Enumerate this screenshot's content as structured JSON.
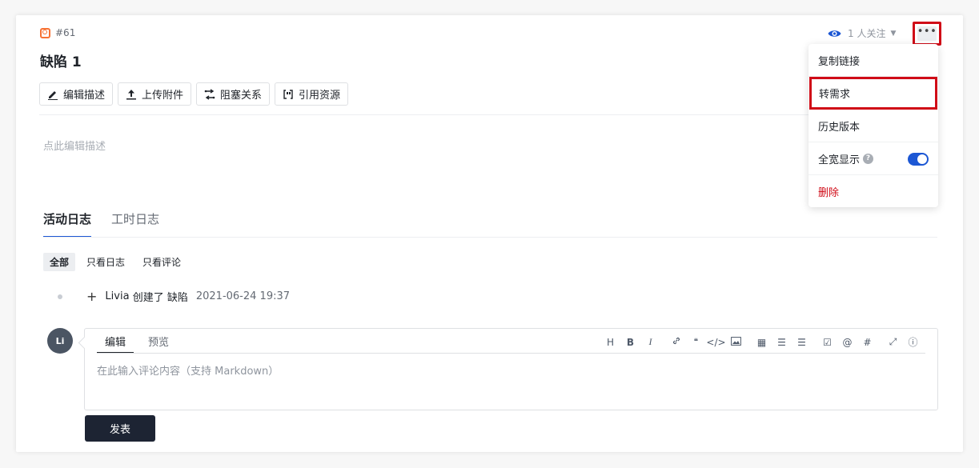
{
  "issue": {
    "id": "#61",
    "title": "缺陷 1",
    "icon": "bug-square-icon",
    "icon_color": "#f77234"
  },
  "watch": {
    "label": "1 人关注",
    "icon": "eye-icon",
    "color": "#1c57d4"
  },
  "more": {
    "label": "•••"
  },
  "toolbar": [
    {
      "label": "编辑描述",
      "icon": "pencil-icon"
    },
    {
      "label": "上传附件",
      "icon": "upload-icon"
    },
    {
      "label": "阻塞关系",
      "icon": "relation-icon"
    },
    {
      "label": "引用资源",
      "icon": "quote-icon"
    }
  ],
  "description": {
    "placeholder": "点此编辑描述"
  },
  "tabs": [
    {
      "label": "活动日志",
      "active": true
    },
    {
      "label": "工时日志",
      "active": false
    }
  ],
  "filters": [
    {
      "label": "全部",
      "active": true
    },
    {
      "label": "只看日志",
      "active": false
    },
    {
      "label": "只看评论",
      "active": false
    }
  ],
  "activity": {
    "user": "Livia",
    "action": "创建了",
    "object": "缺陷",
    "time": "2021-06-24 19:37"
  },
  "comment": {
    "avatar_text": "Li",
    "tab_edit": "编辑",
    "tab_preview": "预览",
    "placeholder": "在此输入评论内容（支持 Markdown）",
    "submit": "发表",
    "tools": [
      "H",
      "B",
      "I",
      "link",
      "quote",
      "code",
      "image",
      "table",
      "ordered-list",
      "unordered-list",
      "checkbox",
      "@",
      "#",
      "fullscreen",
      "help"
    ]
  },
  "menu": {
    "copy_link": "复制链接",
    "convert": "转需求",
    "history": "历史版本",
    "full_width": "全宽显示",
    "full_width_on": true,
    "delete": "删除"
  },
  "colors": {
    "accent": "#1c57d4",
    "danger": "#d00b17",
    "highlight_border": "#d00b17"
  }
}
